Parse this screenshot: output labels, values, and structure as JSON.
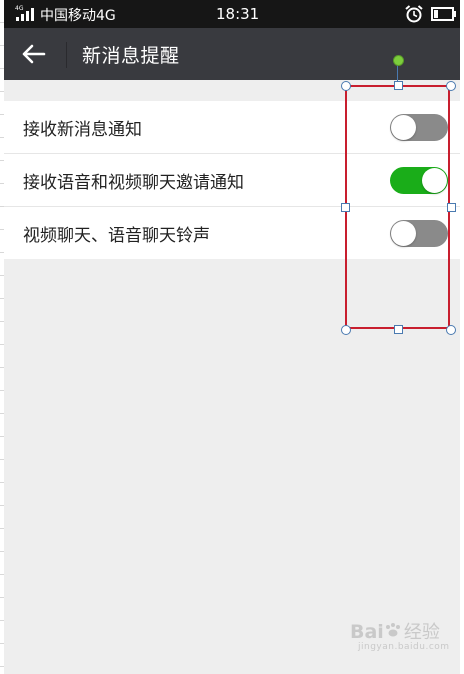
{
  "status_bar": {
    "network_badge": "4G",
    "carrier": "中国移动4G",
    "time": "18:31",
    "alarm_icon": "alarm-clock-icon",
    "battery_icon": "battery-icon"
  },
  "app_bar": {
    "back_icon": "back-arrow-icon",
    "title": "新消息提醒"
  },
  "settings": [
    {
      "label": "接收新消息通知",
      "enabled": false
    },
    {
      "label": "接收语音和视频聊天邀请通知",
      "enabled": true
    },
    {
      "label": "视频聊天、语音聊天铃声",
      "enabled": false
    }
  ],
  "colors": {
    "status_bar_bg": "#161616",
    "app_bar_bg": "#393a3f",
    "toggle_on": "#1aad19",
    "toggle_off": "#8a8a8a",
    "page_bg": "#eeeeee",
    "selection_border": "#c81e2e"
  },
  "watermark": {
    "logo": "Bai",
    "text": "经验",
    "url": "jingyan.baidu.com"
  }
}
